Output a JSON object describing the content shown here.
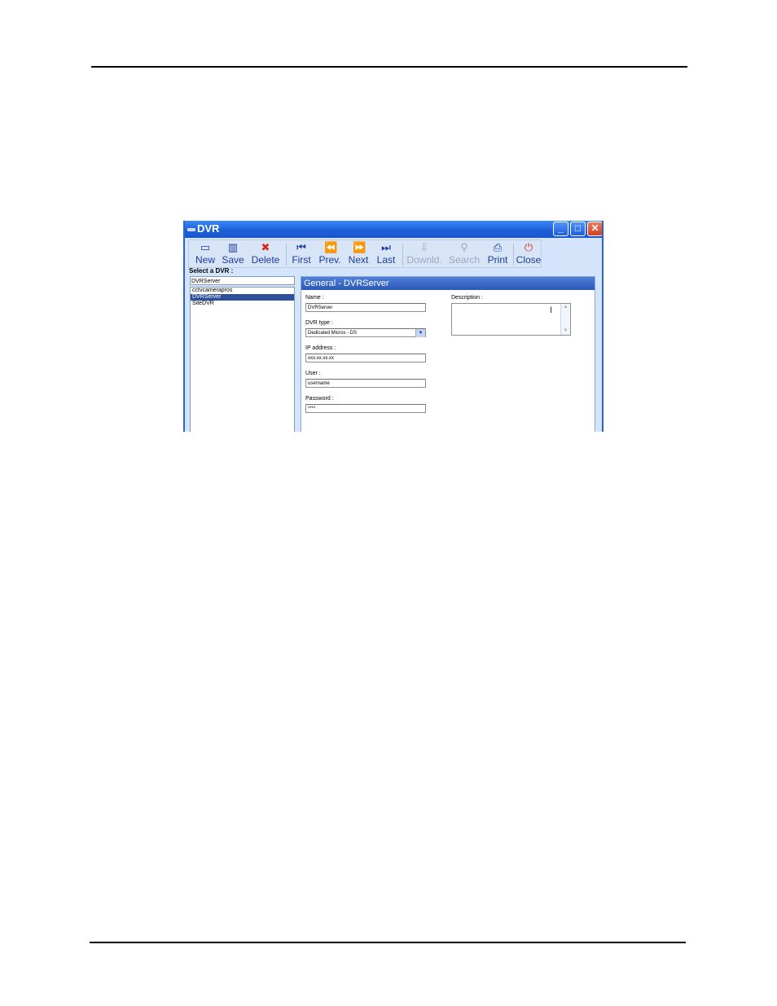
{
  "window": {
    "title": "DVR",
    "controls": {
      "minimize": "_",
      "maximize": "□",
      "close": "✕"
    }
  },
  "toolbar": {
    "buttons": [
      {
        "label": "New",
        "icon": "new-icon",
        "glyph": "▭",
        "enabled": true
      },
      {
        "label": "Save",
        "icon": "save-icon",
        "glyph": "▥",
        "enabled": true
      },
      {
        "label": "Delete",
        "icon": "delete-icon",
        "glyph": "✖",
        "enabled": true
      },
      {
        "label": "First",
        "icon": "first-icon",
        "glyph": "⏮",
        "enabled": true
      },
      {
        "label": "Prev.",
        "icon": "prev-icon",
        "glyph": "⏪",
        "enabled": true
      },
      {
        "label": "Next",
        "icon": "next-icon",
        "glyph": "⏩",
        "enabled": true
      },
      {
        "label": "Last",
        "icon": "last-icon",
        "glyph": "⏭",
        "enabled": true
      },
      {
        "label": "Downld.",
        "icon": "download-icon",
        "glyph": "⇩",
        "enabled": false
      },
      {
        "label": "Search",
        "icon": "search-icon",
        "glyph": "⚲",
        "enabled": false
      },
      {
        "label": "Print",
        "icon": "print-icon",
        "glyph": "⎙",
        "enabled": true
      },
      {
        "label": "Close",
        "icon": "close-icon",
        "glyph": "⏻",
        "enabled": true
      }
    ]
  },
  "selector": {
    "label": "Select a DVR :",
    "value": "DVRServer",
    "items": [
      "cctvcamerapros",
      "DVRServer",
      "SiteDVR"
    ],
    "selected_index": 1
  },
  "panel": {
    "title": "General - DVRServer",
    "name_label": "Name :",
    "name_value": "DVRServer",
    "type_label": "DVR type :",
    "type_value": "Dedicated Micros - DS",
    "ip_label": "IP address :",
    "ip_value": "xxx.xx.xx.xx",
    "user_label": "User :",
    "user_value": "username",
    "password_label": "Password :",
    "password_value": "****",
    "description_label": "Description :",
    "description_value": ""
  },
  "colors": {
    "titlebar": "#1d5fd9",
    "selection": "#2d4f9c",
    "panel_header": "#3a69c7"
  }
}
